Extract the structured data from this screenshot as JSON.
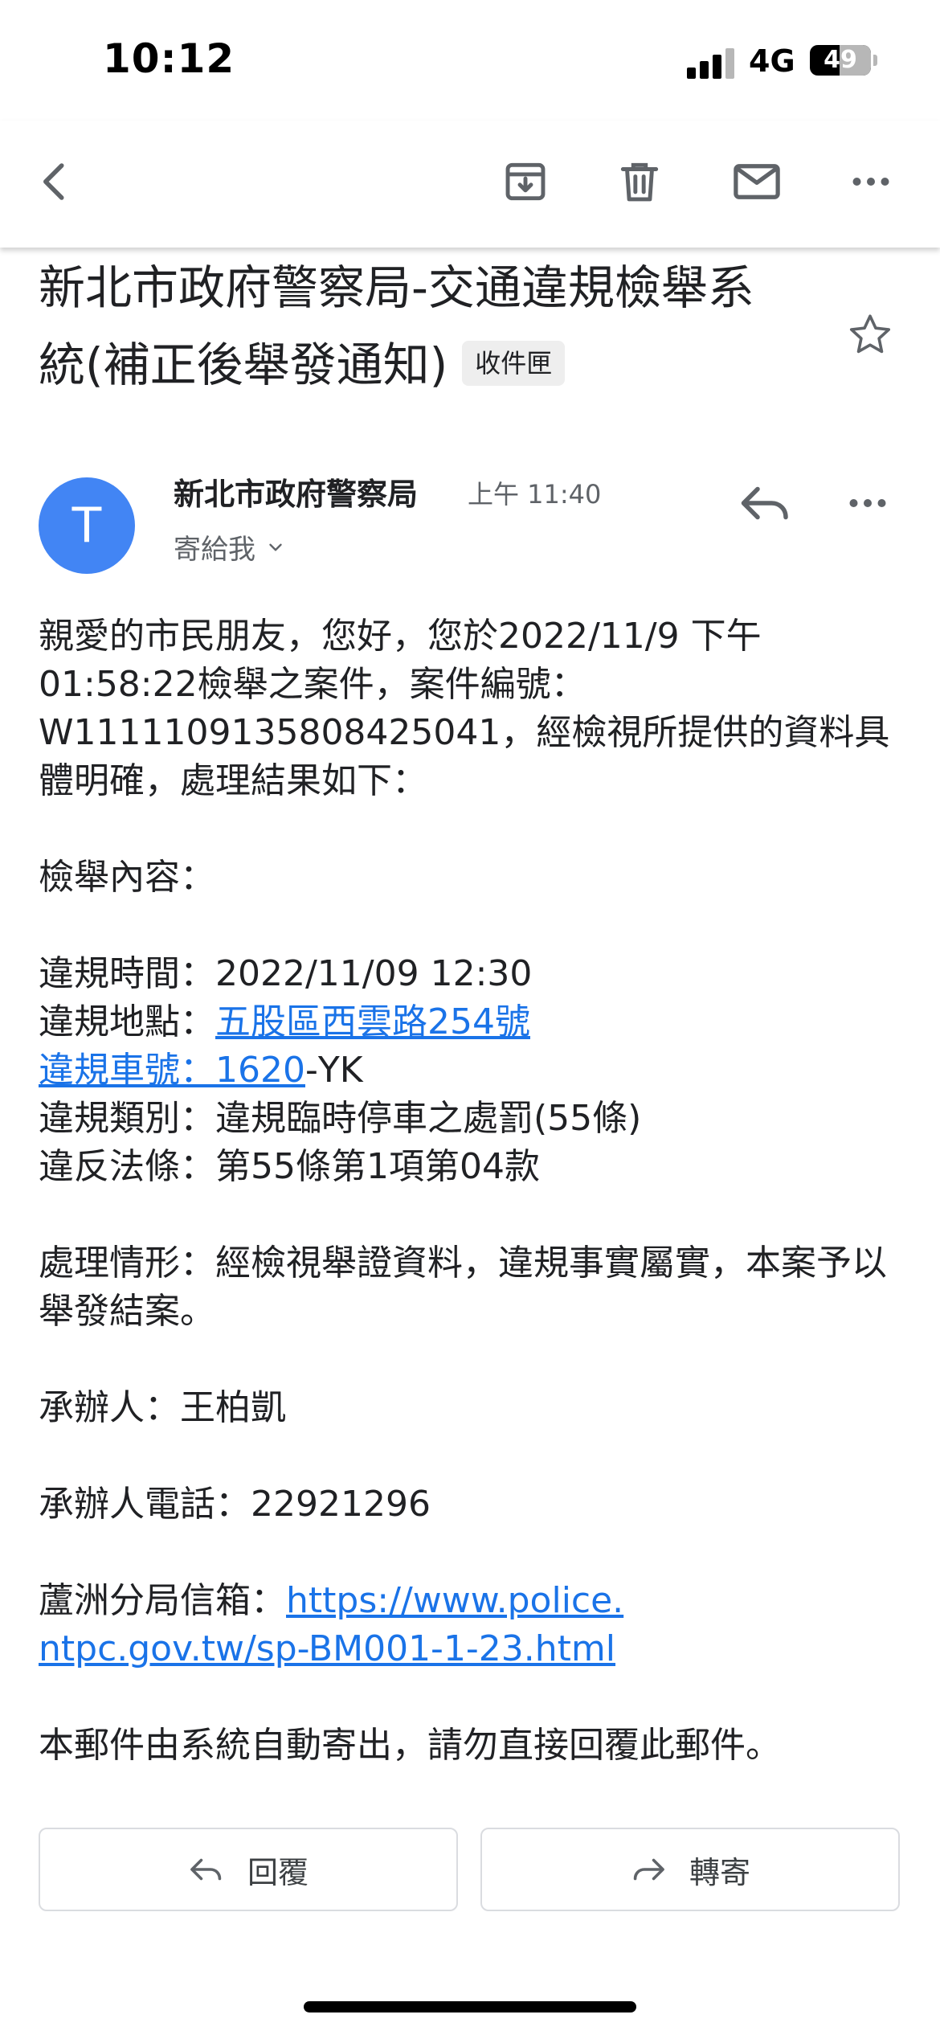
{
  "status_bar": {
    "time": "10:12",
    "network": "4G",
    "battery": "49",
    "battery_level_percent": 49
  },
  "toolbar": {
    "back_icon": "chevron-left-icon",
    "archive_icon": "archive-icon",
    "delete_icon": "trash-icon",
    "mark_unread_icon": "mail-icon",
    "more_icon": "more-horizontal-icon"
  },
  "email": {
    "subject": "新北市政府警察局-交通違規檢舉系統(補正後舉發通知)",
    "label": "收件匣",
    "sender": {
      "avatar_letter": "T",
      "name": "新北市政府警察局",
      "time": "上午 11:40",
      "recipient": "寄給我"
    },
    "body": {
      "intro_1": "親愛的市民朋友，您好，您於2022/11/9 下午01:58:22檢舉之案件，案件編號：W1111109135808425041，經檢視所提供的資料具體明確，處理結果如下：",
      "section_title": "檢舉內容：",
      "violation_time": "違規時間：2022/11/09 12:30",
      "location_label": "違規地點：",
      "location_link": "五股區西雲路254號",
      "plate_link": "違規車號：1620",
      "plate_suffix": "-YK",
      "category": "違規類別：違規臨時停車之處罰(55條)",
      "law": "違反法條：第55條第1項第04款",
      "handling": "處理情形：經檢視舉證資料，違規事實屬實，本案予以舉發結案。",
      "officer": "承辦人：王柏凱",
      "officer_phone": "承辦人電話：22921296",
      "mailbox_label": "蘆洲分局信箱：",
      "mailbox_link_1": "https://www.police.",
      "mailbox_link_2": "ntpc.gov.tw/sp-BM001-1-23.html",
      "footer_note": "本郵件由系統自動寄出，請勿直接回覆此郵件。"
    }
  },
  "actions": {
    "reply_label": "回覆",
    "forward_label": "轉寄"
  },
  "colors": {
    "link": "#1a73e8",
    "avatar": "#4285f4",
    "icon": "#5f6368"
  }
}
